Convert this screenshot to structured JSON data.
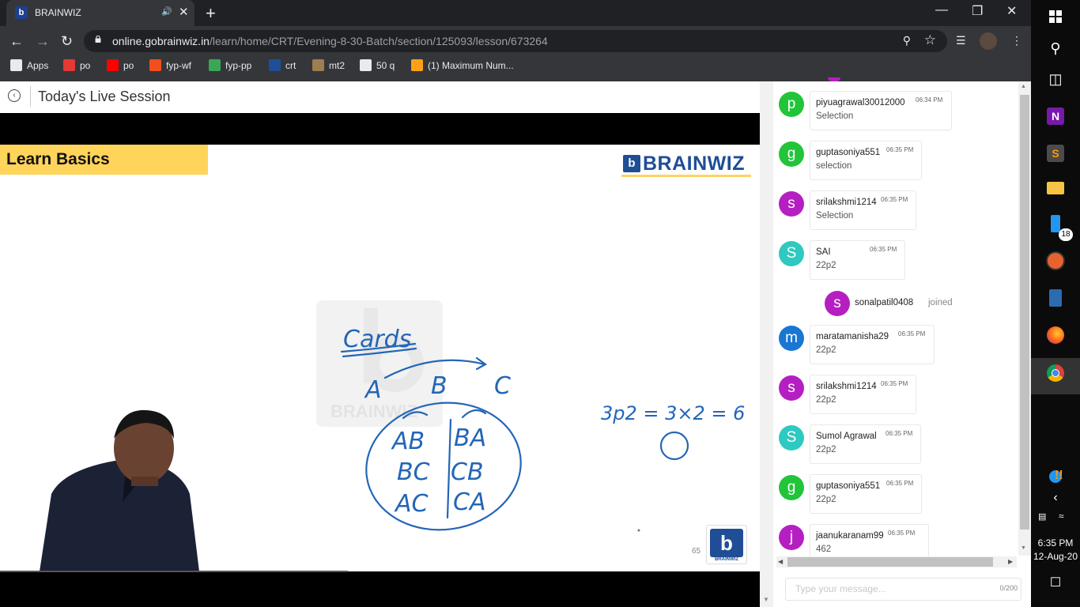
{
  "browser": {
    "tab_title": "BRAINWIZ",
    "url_host": "online.gobrainwiz.in",
    "url_path": "/learn/home/CRT/Evening-8-30-Batch/section/125093/lesson/673264",
    "bookmarks": [
      {
        "label": "Apps",
        "icon": "apps-grid-icon",
        "color": "#e8eaed"
      },
      {
        "label": "po",
        "icon": "edge-icon",
        "color": "#e53935"
      },
      {
        "label": "po",
        "icon": "youtube-icon",
        "color": "#ff0000"
      },
      {
        "label": "fyp-wf",
        "icon": "figma-icon",
        "color": "#f24e1e"
      },
      {
        "label": "fyp-pp",
        "icon": "pp-icon",
        "color": "#3aa757"
      },
      {
        "label": "crt",
        "icon": "brainwiz-icon",
        "color": "#1f4e96"
      },
      {
        "label": "mt2",
        "icon": "cc-icon",
        "color": "#9e7d4e"
      },
      {
        "label": "50 q",
        "icon": "globe-icon",
        "color": "#e8eaed"
      },
      {
        "label": "(1) Maximum Num...",
        "icon": "leetcode-icon",
        "color": "#ffa116"
      }
    ]
  },
  "session": {
    "title": "Today's Live Session"
  },
  "slide": {
    "banner": "Learn Basics",
    "brand": "BRAINWIZ",
    "watermark": "BRAINWIZ",
    "page_number": "65",
    "corner_logo_text": "BRAINWIZ",
    "notes": {
      "heading": "Cards",
      "letters": [
        "A",
        "B",
        "C"
      ],
      "pairs_left": [
        "AB",
        "BC",
        "AC"
      ],
      "pairs_right": [
        "BA",
        "CB",
        "CA"
      ],
      "formula": "3p2 = 3×2 = 6"
    }
  },
  "chat": {
    "messages": [
      {
        "user": "piyuagrawal30012000",
        "time": "06:34 PM",
        "text": "Selection",
        "initial": "p",
        "color": "#22c43a"
      },
      {
        "user": "guptasoniya551",
        "time": "06:35 PM",
        "text": "selection",
        "initial": "g",
        "color": "#22c43a"
      },
      {
        "user": "srilakshmi1214",
        "time": "06:35 PM",
        "text": "Selection",
        "initial": "s",
        "color": "#b51fc2"
      },
      {
        "user": "SAI",
        "time": "06:35 PM",
        "text": "22p2",
        "initial": "S",
        "color": "#2ec9c0"
      },
      {
        "user": "maratamanisha29",
        "time": "06:35 PM",
        "text": "22p2",
        "initial": "m",
        "color": "#1976d2"
      },
      {
        "user": "srilakshmi1214",
        "time": "06:35 PM",
        "text": "22p2",
        "initial": "s",
        "color": "#b51fc2"
      },
      {
        "user": "Sumol Agrawal",
        "time": "06:35 PM",
        "text": "22p2",
        "initial": "S",
        "color": "#2ec9c0"
      },
      {
        "user": "guptasoniya551",
        "time": "06:35 PM",
        "text": "22p2",
        "initial": "g",
        "color": "#22c43a"
      },
      {
        "user": "jaanukaranam99",
        "time": "06:35 PM",
        "text": "462",
        "initial": "j",
        "color": "#b51fc2"
      }
    ],
    "join_event": {
      "user": "sonalpatil0408",
      "action": "joined",
      "initial": "s",
      "color": "#b51fc2"
    },
    "input_placeholder": "Type your message...",
    "char_count": "0/200"
  },
  "taskbar": {
    "time": "6:35 PM",
    "date": "12-Aug-20",
    "badge": "18"
  }
}
